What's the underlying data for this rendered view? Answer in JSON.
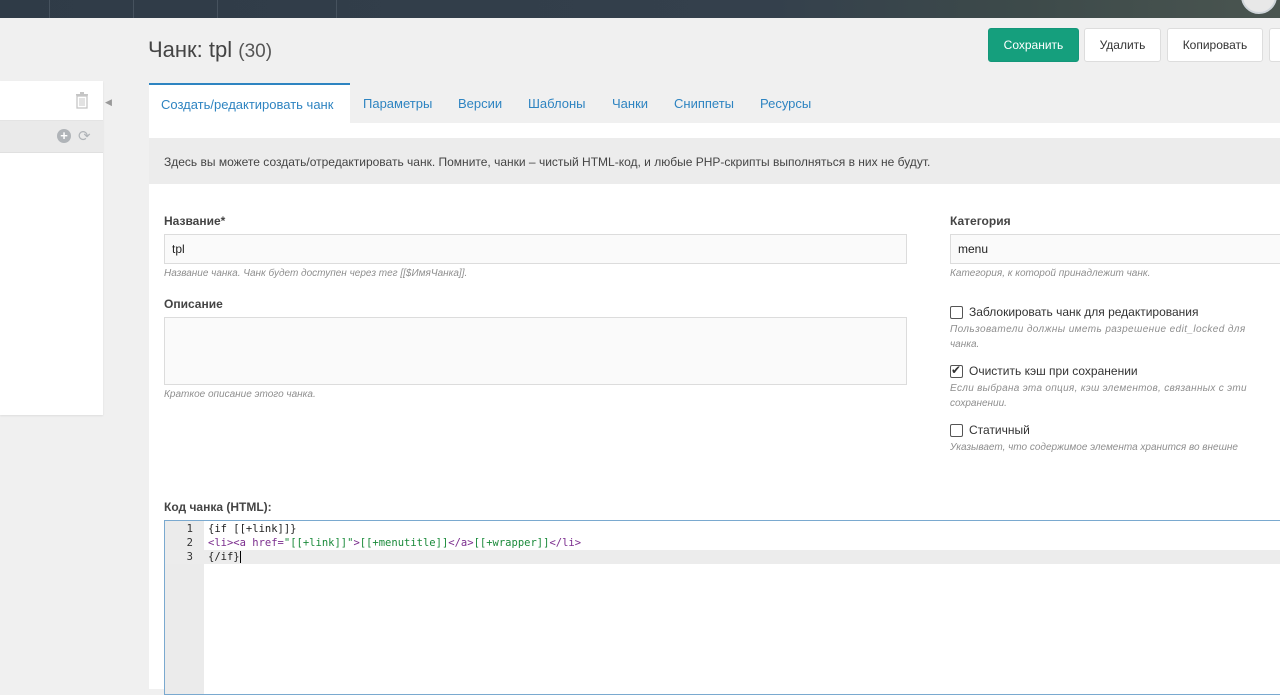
{
  "page": {
    "title": "Чанк: tpl",
    "count": "(30)"
  },
  "actions": {
    "save": "Сохранить",
    "delete": "Удалить",
    "copy": "Копировать"
  },
  "tabs": [
    {
      "label": "Создать/редактировать чанк",
      "active": true
    },
    {
      "label": "Параметры"
    },
    {
      "label": "Версии"
    },
    {
      "label": "Шаблоны"
    },
    {
      "label": "Чанки"
    },
    {
      "label": "Сниппеты"
    },
    {
      "label": "Ресурсы"
    }
  ],
  "info": "Здесь вы можете создать/отредактировать чанк. Помните, чанки – чистый HTML-код, и любые PHP-скрипты выполняться в них не будут.",
  "form": {
    "name_label": "Название*",
    "name_value": "tpl",
    "name_hint": "Название чанка. Чанк будет доступен через тег [[$ИмяЧанка]].",
    "description_label": "Описание",
    "description_value": "",
    "description_hint": "Краткое описание этого чанка.",
    "category_label": "Категория",
    "category_value": "menu",
    "category_hint": "Категория, к которой принадлежит чанк.",
    "lock_label": "Заблокировать чанк для редактирования",
    "lock_checked": false,
    "lock_hint_1": "Пользователи должны иметь разрешение edit_locked для",
    "lock_hint_2": "чанка.",
    "clear_cache_label": "Очистить кэш при сохранении",
    "clear_cache_checked": true,
    "clear_cache_hint_1": "Если выбрана эта опция, кэш элементов, связанных с эти",
    "clear_cache_hint_2": "сохранении.",
    "static_label": "Статичный",
    "static_checked": false,
    "static_hint": "Указывает, что содержимое элемента хранится во внешне"
  },
  "editor": {
    "label": "Код чанка (HTML):",
    "line_numbers": [
      "1",
      "2",
      "3"
    ],
    "lines": [
      "{if [[+link]]}",
      "<li><a href=\"[[+link]]\">[[+menutitle]]</a>[[+wrapper]]</li>",
      "{/if}"
    ]
  },
  "colors": {
    "accent": "#2e84c1",
    "save_button": "#159f7d",
    "topbar": "#2f3b47"
  }
}
